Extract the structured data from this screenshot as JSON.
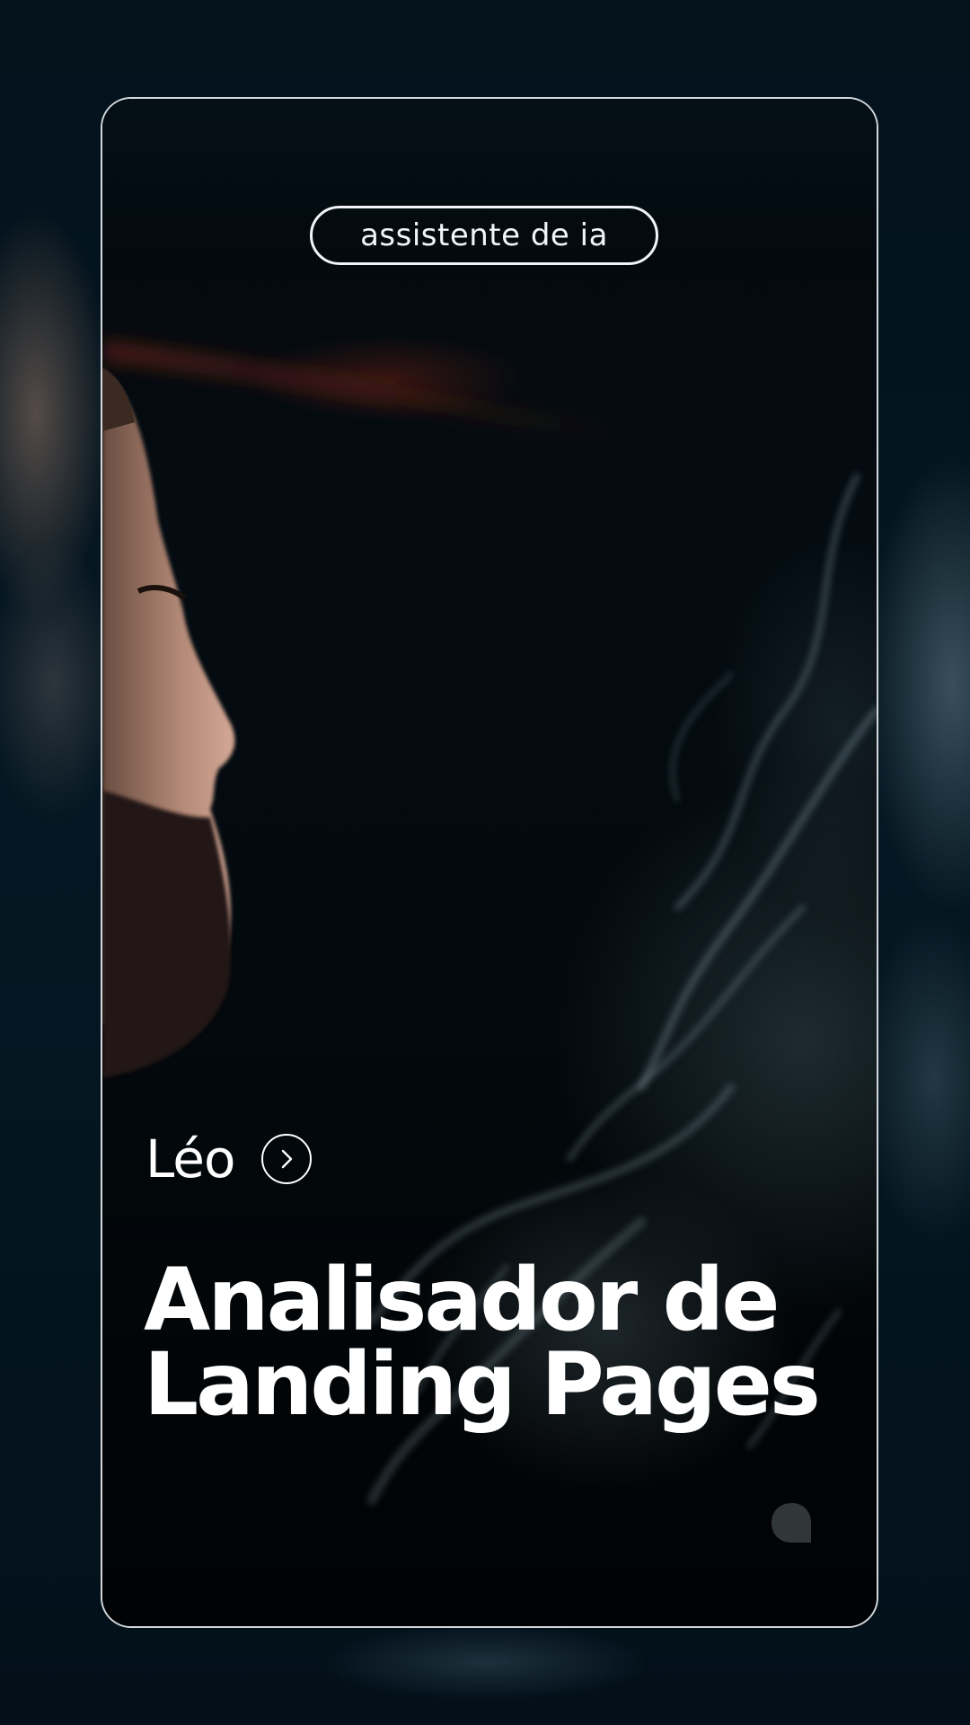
{
  "badge": {
    "label": "assistente de ia"
  },
  "author": {
    "name": "Léo",
    "icon": "chevron-right-icon"
  },
  "title": {
    "line1": "Analisador de",
    "line2": "Landing Pages"
  },
  "chat": {
    "icon": "chat-bubble-icon"
  },
  "colors": {
    "background": "#04111b",
    "card_border": "#e6ecf0",
    "text": "#ffffff"
  }
}
